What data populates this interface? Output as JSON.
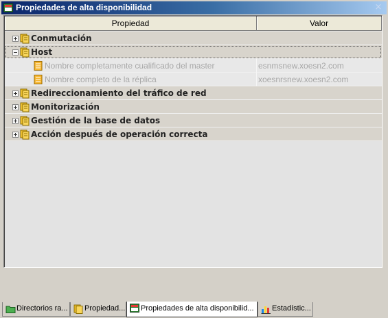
{
  "window": {
    "title": "Propiedades de alta disponibilidad",
    "close_glyph": "×"
  },
  "grid": {
    "columns": {
      "property": "Propiedad",
      "value": "Valor"
    },
    "groups": [
      {
        "label": "Conmutación",
        "expanded": false
      },
      {
        "label": "Host",
        "expanded": true,
        "children": [
          {
            "label": "Nombre completamente cualificado del master",
            "value": "esnmsnew.xoesn2.com"
          },
          {
            "label": "Nombre completo de la réplica",
            "value": "xoesnrsnew.xoesn2.com"
          }
        ]
      },
      {
        "label": "Redireccionamiento del tráfico de red",
        "expanded": false
      },
      {
        "label": "Monitorización",
        "expanded": false
      },
      {
        "label": "Gestión de la base de datos",
        "expanded": false
      },
      {
        "label": "Acción después de operación correcta",
        "expanded": false
      }
    ]
  },
  "tabs": [
    {
      "label": "Directorios ra...",
      "icon": "folder-icon",
      "active": false
    },
    {
      "label": "Propiedad...",
      "icon": "properties-icon",
      "active": false
    },
    {
      "label": "Propiedades de alta disponibilid...",
      "icon": "ha-properties-icon",
      "active": true
    },
    {
      "label": "Estadístic...",
      "icon": "statistics-icon",
      "active": false
    }
  ],
  "colors": {
    "titlebar_start": "#0a246a",
    "titlebar_end": "#a6caf0",
    "group_row": "#d8d4cc",
    "disabled_text": "#a8a8a8"
  }
}
